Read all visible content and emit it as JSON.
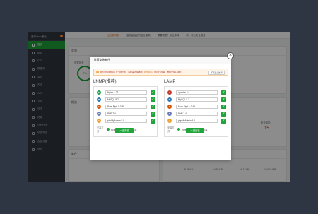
{
  "sidebar": {
    "brand": "宝塔Linux面板",
    "version": "6",
    "items": [
      {
        "label": "首页"
      },
      {
        "label": "网站"
      },
      {
        "label": "FTP"
      },
      {
        "label": "数据库"
      },
      {
        "label": "监控"
      },
      {
        "label": "安全"
      },
      {
        "label": "WAF"
      },
      {
        "label": "文件"
      },
      {
        "label": "日志"
      },
      {
        "label": "终端"
      },
      {
        "label": "计划任务"
      },
      {
        "label": "软件商店"
      },
      {
        "label": "面板设置"
      },
      {
        "label": "退出"
      }
    ]
  },
  "topbar": {
    "items": [
      "企业版特权",
      "宝塔面板官方企业服务",
      "需要帮助？点此申请",
      "新一代云安全服务"
    ]
  },
  "dashboard": {
    "status_title": "状态",
    "load_label": "负载状态",
    "load_value": "0%",
    "overview_title": "概览",
    "risk_label": "安全风险",
    "risk_value": "15",
    "software_title": "软件",
    "traffic_title": "流量",
    "disk_values": [
      "9.76 KB",
      "14.93 KB",
      "16.13 MB",
      "154.15 MB"
    ]
  },
  "modal": {
    "title": "推荐安装套件",
    "notice_text": "我们为您推荐以下一键套件，请按需选择或在",
    "notice_link": "软件商店",
    "notice_tail": "中自行选择，推荐安装LNMP。",
    "notice_button": "不再显示推荐",
    "close": "×",
    "lnmp": {
      "title": "LNMP(推荐)",
      "rows": [
        {
          "icon": "nginx-icon",
          "value": "Nginx 1.22",
          "color": "#1fa34a",
          "glyph": "N"
        },
        {
          "icon": "mysql-icon",
          "value": "MySQL 5.7",
          "color": "#2d7bb6",
          "glyph": "M"
        },
        {
          "icon": "pureftpd-icon",
          "value": "Pure-Ftpd 1.0.49",
          "color": "#d35400",
          "glyph": "F"
        },
        {
          "icon": "php-icon",
          "value": "PHP 7.4",
          "color": "#6b7ab5",
          "glyph": "P"
        },
        {
          "icon": "phpmyadmin-icon",
          "value": "phpMyAdmin 5.0",
          "color": "#f0a030",
          "glyph": "A"
        }
      ],
      "mode_label": "安装方式",
      "mode_fast": "极速安装",
      "mode_compile": "编译安装",
      "button": "一键安装"
    },
    "lamp": {
      "title": "LAMP",
      "rows": [
        {
          "icon": "apache-icon",
          "value": "Apache 2.4",
          "color": "#c0392b",
          "glyph": "A"
        },
        {
          "icon": "mysql-icon",
          "value": "MySQL 5.7",
          "color": "#2d7bb6",
          "glyph": "M"
        },
        {
          "icon": "pureftpd-icon",
          "value": "Pure-Ftpd 1.0.49",
          "color": "#d35400",
          "glyph": "F"
        },
        {
          "icon": "php-icon",
          "value": "PHP 7.4",
          "color": "#6b7ab5",
          "glyph": "P"
        },
        {
          "icon": "phpmyadmin-icon",
          "value": "phpMyAdmin 5.0",
          "color": "#f0a030",
          "glyph": "A"
        }
      ],
      "mode_label": "安装方式",
      "mode_fast": "极速安装",
      "mode_compile": "编译安装",
      "button": "一键安装"
    }
  },
  "colors": {
    "accent": "#20a53a",
    "sidebar": "#30353f",
    "warning": "#e8792e"
  }
}
